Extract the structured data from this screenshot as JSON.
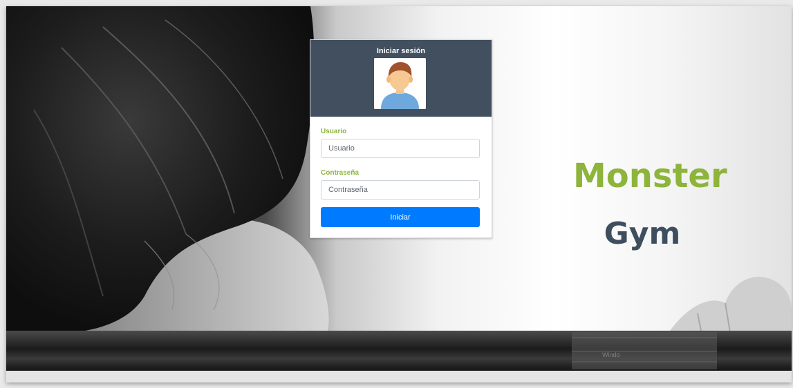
{
  "login": {
    "title": "Iniciar sesión",
    "username_label": "Usuario",
    "username_placeholder": "Usuario",
    "password_label": "Contraseña",
    "password_placeholder": "Contraseña",
    "submit_label": "Iniciar"
  },
  "brand": {
    "primary": "Monster",
    "secondary": "Gym"
  },
  "watermark": "Windo",
  "colors": {
    "header": "#414f5f",
    "accent_green": "#8db43b",
    "brand_dark": "#3e4e5e",
    "button": "#007bff"
  },
  "icons": {
    "avatar": "user-avatar-icon"
  }
}
